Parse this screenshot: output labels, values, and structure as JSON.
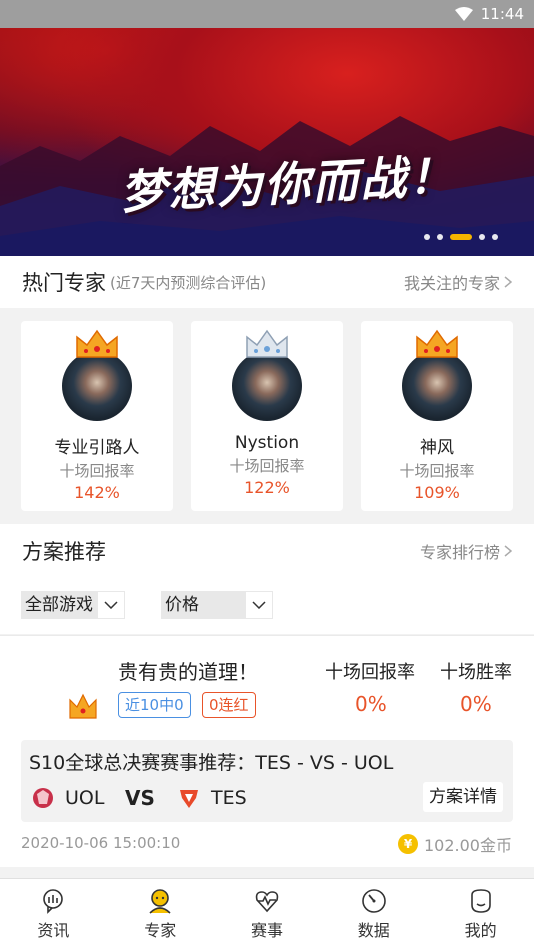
{
  "status_bar": {
    "time": "11:44",
    "wifi_icon": "wifi-icon"
  },
  "banner": {
    "slogan": "梦想为你而战！",
    "dots": 5,
    "active_dot": 3
  },
  "hot_experts": {
    "title": "热门专家",
    "subtitle": "(近7天内预测综合评估)",
    "more_link": "我关注的专家",
    "experts": [
      {
        "name": "专业引路人",
        "label": "十场回报率",
        "rate": "142%",
        "crown": "gold"
      },
      {
        "name": "Nystion",
        "label": "十场回报率",
        "rate": "122%",
        "crown": "silver"
      },
      {
        "name": "神风",
        "label": "十场回报率",
        "rate": "109%",
        "crown": "gold"
      }
    ]
  },
  "plans": {
    "title": "方案推荐",
    "more_link": "专家排行榜",
    "filters": [
      {
        "label": "全部游戏"
      },
      {
        "label": "价格"
      }
    ],
    "items": [
      {
        "expert_name": "贵有贵的道理！",
        "tags": [
          "近10中0",
          "0连红"
        ],
        "stats": [
          {
            "header": "十场回报率",
            "value": "0%"
          },
          {
            "header": "十场胜率",
            "value": "0%"
          }
        ],
        "match_title": "S10全球总决赛赛事推荐：TES - VS - UOL",
        "team_a": "UOL",
        "vs": "VS",
        "team_b": "TES",
        "detail_button": "方案详情",
        "time": "2020-10-06 15:00:10",
        "coin_symbol": "¥",
        "price": "102.00金币"
      }
    ]
  },
  "tabbar": [
    {
      "label": "资讯",
      "icon": "news-icon"
    },
    {
      "label": "专家",
      "icon": "expert-icon"
    },
    {
      "label": "赛事",
      "icon": "match-icon"
    },
    {
      "label": "数据",
      "icon": "data-icon"
    },
    {
      "label": "我的",
      "icon": "profile-icon"
    }
  ],
  "colors": {
    "accent_red": "#e8542a",
    "accent_blue": "#4a90e2",
    "active_dot": "#f5b400"
  }
}
